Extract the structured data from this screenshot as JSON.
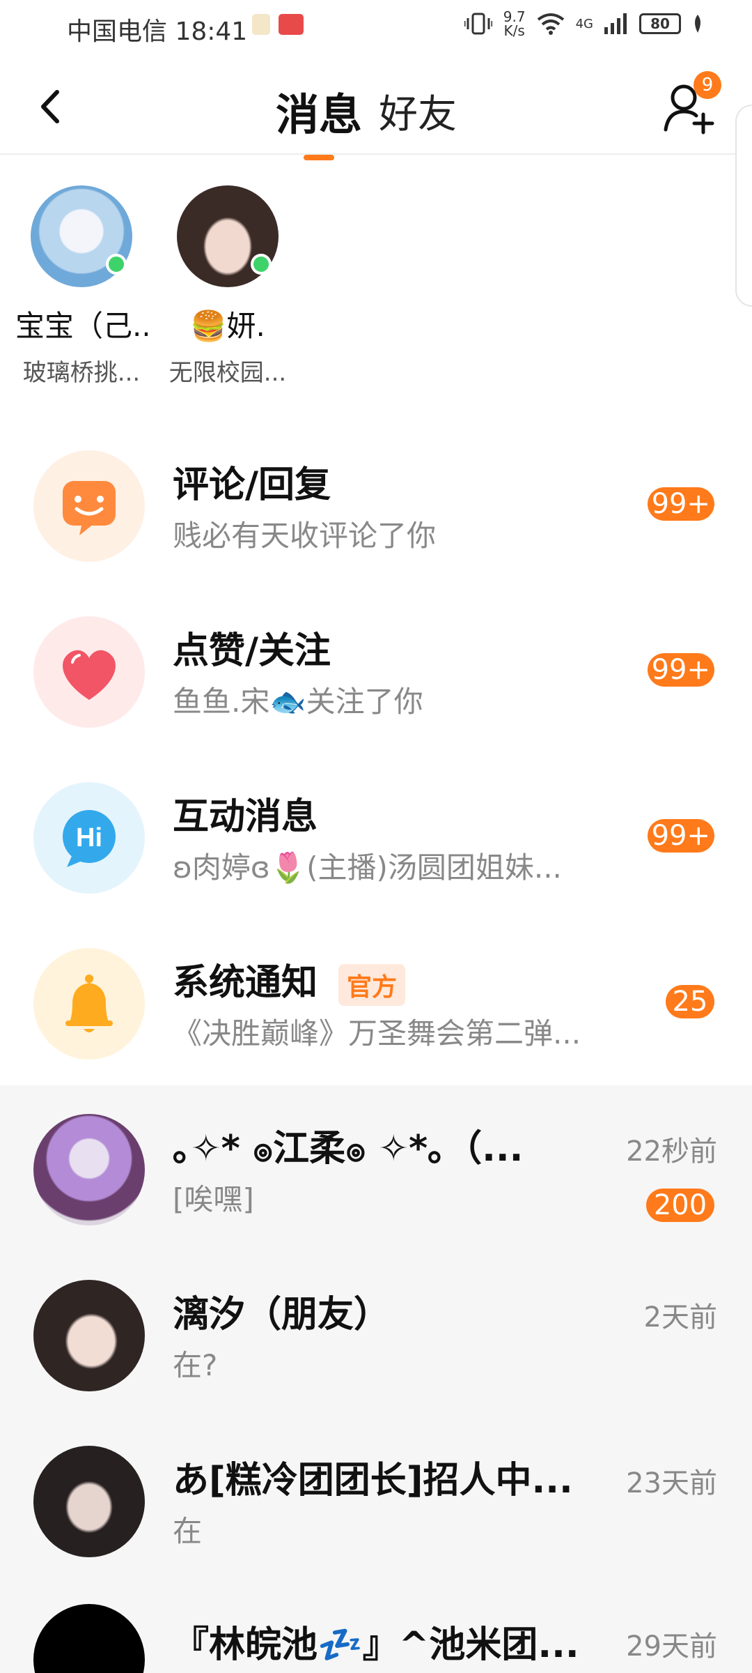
{
  "status_bar": {
    "carrier_time": "中国电信 18:41",
    "net_speed_value": "9.7",
    "net_speed_unit": "K/s",
    "network": "4G",
    "battery": "80"
  },
  "header": {
    "tab_messages": "消息",
    "tab_friends": "好友",
    "add_friend_badge": "9"
  },
  "friends": [
    {
      "name": "宝宝（己...",
      "subtitle": "玻璃桥挑..."
    },
    {
      "name": "🍔妍.",
      "subtitle": "无限校园..."
    }
  ],
  "categories": [
    {
      "title": "评论/回复",
      "subtitle": "贱必有天收评论了你",
      "badge": "99+",
      "icon": "smile-chat-icon"
    },
    {
      "title": "点赞/关注",
      "subtitle": "鱼鱼.宋🐟关注了你",
      "badge": "99+",
      "icon": "heart-icon"
    },
    {
      "title": "互动消息",
      "subtitle": "ʚ肉婷ɞ🌷(主播)汤圆团姐妹...",
      "badge": "99+",
      "icon": "hi-bubble-icon"
    },
    {
      "title": "系统通知",
      "tag": "官方",
      "subtitle": "《决胜巅峰》万圣舞会第二弹...",
      "badge": "25",
      "icon": "bell-icon"
    }
  ],
  "chats": [
    {
      "name": "｡✧* ၜ江柔ၜ ✧*｡（...",
      "preview": "[唉嘿]",
      "time": "22秒前",
      "badge": "200"
    },
    {
      "name": "漓汐（朋友）",
      "preview": "在?",
      "time": "2天前",
      "badge": ""
    },
    {
      "name": "あ[糕冷团团长]招人中...",
      "preview": "在",
      "time": "23天前",
      "badge": ""
    },
    {
      "name": "『林皖池💤』^池米团...",
      "preview": "",
      "time": "29天前",
      "badge": ""
    }
  ],
  "colors": {
    "accent": "#ff7a1a",
    "online": "#3ed36a"
  }
}
